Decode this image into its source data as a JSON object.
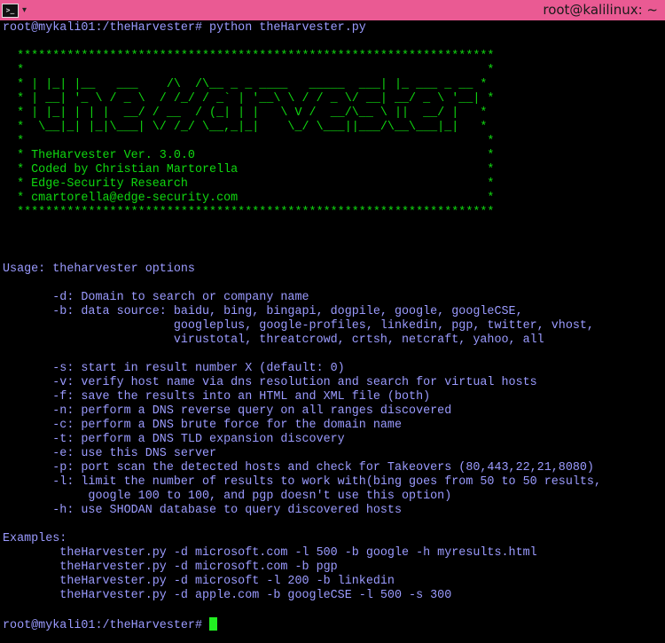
{
  "window": {
    "title": "root@kalilinux: ~",
    "icon": "terminal-icon",
    "menu_icon": "chevron-down-icon"
  },
  "colors": {
    "titlebar": "#ea5a93",
    "background": "#000000",
    "text": "#9b9bff",
    "banner": "#10d810",
    "cursor": "#22ee22"
  },
  "terminal": {
    "command_line": "root@mykali01:/theHarvester# python theHarvester.py",
    "banner": [
      "  *******************************************************************",
      "  *                                                                 *",
      "  * | |_| |__   ___    /\\  /\\__ _ _ ____   _____  ___| |_ ___ _ __ *",
      "  * | __| '_ \\ / _ \\  / /_/ / _` | '__\\ \\ / / _ \\/ __| __/ _ \\ '__| *",
      "  * | |_| | | |  __/ / __  / (_| | |   \\ V /  __/\\__ \\ ||  __/ |   *",
      "  *  \\__|_| |_|\\___| \\/ /_/ \\__,_|_|    \\_/ \\___||___/\\__\\___|_|   *",
      "  *                                                                 *",
      "  * TheHarvester Ver. 3.0.0                                         *",
      "  * Coded by Christian Martorella                                   *",
      "  * Edge-Security Research                                          *",
      "  * cmartorella@edge-security.com                                   *",
      "  *******************************************************************"
    ],
    "usage": [
      "Usage: theharvester options",
      "",
      "       -d: Domain to search or company name",
      "       -b: data source: baidu, bing, bingapi, dogpile, google, googleCSE,",
      "                        googleplus, google-profiles, linkedin, pgp, twitter, vhost,",
      "                        virustotal, threatcrowd, crtsh, netcraft, yahoo, all",
      "",
      "       -s: start in result number X (default: 0)",
      "       -v: verify host name via dns resolution and search for virtual hosts",
      "       -f: save the results into an HTML and XML file (both)",
      "       -n: perform a DNS reverse query on all ranges discovered",
      "       -c: perform a DNS brute force for the domain name",
      "       -t: perform a DNS TLD expansion discovery",
      "       -e: use this DNS server",
      "       -p: port scan the detected hosts and check for Takeovers (80,443,22,21,8080)",
      "       -l: limit the number of results to work with(bing goes from 50 to 50 results,",
      "            google 100 to 100, and pgp doesn't use this option)",
      "       -h: use SHODAN database to query discovered hosts",
      "",
      "Examples:",
      "        theHarvester.py -d microsoft.com -l 500 -b google -h myresults.html",
      "        theHarvester.py -d microsoft.com -b pgp",
      "        theHarvester.py -d microsoft -l 200 -b linkedin",
      "        theHarvester.py -d apple.com -b googleCSE -l 500 -s 300"
    ],
    "prompt": "root@mykali01:/theHarvester# "
  }
}
